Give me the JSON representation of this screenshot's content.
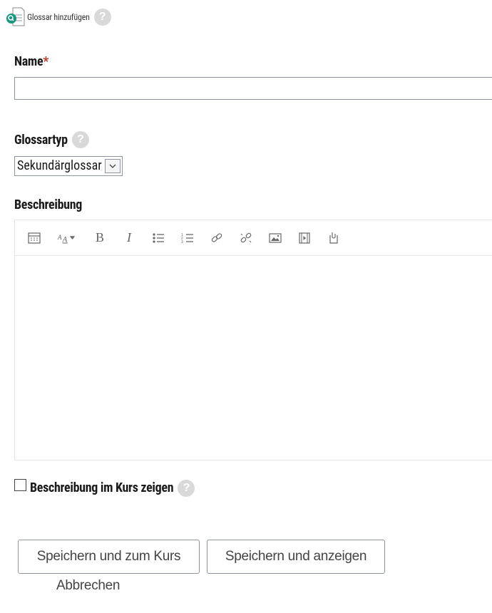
{
  "header": {
    "title": "Glossar hinzufügen",
    "help": "?"
  },
  "form": {
    "name": {
      "label": "Name",
      "required_marker": "*",
      "value": ""
    },
    "glossary_type": {
      "label": "Glossartyp",
      "help": "?",
      "selected": "Sekundärglossar"
    },
    "description": {
      "label": "Beschreibung",
      "toolbar": [
        "toolbar-toggle-icon",
        "font-style-icon",
        "bold-icon",
        "italic-icon",
        "unordered-list-icon",
        "ordered-list-icon",
        "link-icon",
        "unlink-icon",
        "image-icon",
        "media-icon",
        "manage-files-icon"
      ],
      "bold_glyph": "B",
      "italic_glyph": "I",
      "content": ""
    },
    "show_description": {
      "label": "Beschreibung im Kurs zeigen",
      "checked": false,
      "help": "?"
    }
  },
  "actions": {
    "save_return": "Speichern und zum Kurs",
    "save_display": "Speichern und anzeigen",
    "cancel": "Abbrechen"
  }
}
